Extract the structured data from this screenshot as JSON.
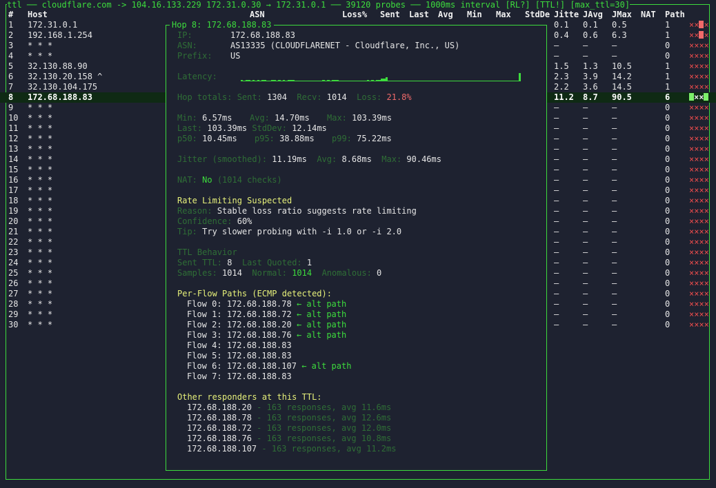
{
  "title_bar": "ttl ── cloudflare.com -> 104.16.133.229 172.31.0.30 → 172.31.0.1 ── 39120 probes ── 1000ms interval [RL?] [TTL!] [max_ttl=30]",
  "headers": {
    "num": "#",
    "host": "Host",
    "asn": "ASN",
    "loss": "Loss%",
    "sent": "Sent",
    "last": "Last",
    "avg": "Avg",
    "min": "Min",
    "max": "Max",
    "stddev": "StdDe",
    "jitter": "Jitte",
    "javg": "JAvg",
    "jmax": "JMax",
    "nat": "NAT",
    "path": "Path"
  },
  "rows": [
    {
      "n": "1",
      "host": "172.31.0.1",
      "j": "0.1",
      "ja": "0.1",
      "jm": "0.5",
      "p": "1",
      "flags": "××",
      "tail": "red-x"
    },
    {
      "n": "2",
      "host": "192.168.1.254",
      "j": "0.4",
      "ja": "0.6",
      "jm": "6.3",
      "p": "1",
      "flags": "××",
      "tail": "red-x"
    },
    {
      "n": "3",
      "host": "* * *",
      "j": "–",
      "ja": "–",
      "jm": "–",
      "p": "0",
      "flags": "××××"
    },
    {
      "n": "4",
      "host": "* * *",
      "j": "–",
      "ja": "–",
      "jm": "–",
      "p": "0",
      "flags": "××××"
    },
    {
      "n": "5",
      "host": "32.130.88.90",
      "j": "1.5",
      "ja": "1.3",
      "jm": "10.5",
      "p": "1",
      "flags": "××××"
    },
    {
      "n": "6",
      "host": "32.130.20.158 ^",
      "j": "2.3",
      "ja": "3.9",
      "jm": "14.2",
      "p": "1",
      "flags": "××××"
    },
    {
      "n": "7",
      "host": "32.130.104.175",
      "j": "2.2",
      "ja": "3.6",
      "jm": "14.5",
      "p": "1",
      "flags": "××××"
    },
    {
      "n": "8",
      "host": "172.68.188.83",
      "j": "11.2",
      "ja": "8.7",
      "jm": "90.5",
      "p": "6",
      "flags": "××",
      "tail": "green",
      "selected": true
    },
    {
      "n": "9",
      "host": "* * *",
      "j": "–",
      "ja": "–",
      "jm": "–",
      "p": "0",
      "flags": "××××"
    },
    {
      "n": "10",
      "host": "* * *",
      "j": "–",
      "ja": "–",
      "jm": "–",
      "p": "0",
      "flags": "××××"
    },
    {
      "n": "11",
      "host": "* * *",
      "j": "–",
      "ja": "–",
      "jm": "–",
      "p": "0",
      "flags": "××××"
    },
    {
      "n": "12",
      "host": "* * *",
      "j": "–",
      "ja": "–",
      "jm": "–",
      "p": "0",
      "flags": "××××"
    },
    {
      "n": "13",
      "host": "* * *",
      "j": "–",
      "ja": "–",
      "jm": "–",
      "p": "0",
      "flags": "××××"
    },
    {
      "n": "14",
      "host": "* * *",
      "j": "–",
      "ja": "–",
      "jm": "–",
      "p": "0",
      "flags": "××××"
    },
    {
      "n": "15",
      "host": "* * *",
      "j": "–",
      "ja": "–",
      "jm": "–",
      "p": "0",
      "flags": "××××"
    },
    {
      "n": "16",
      "host": "* * *",
      "j": "–",
      "ja": "–",
      "jm": "–",
      "p": "0",
      "flags": "××××"
    },
    {
      "n": "17",
      "host": "* * *",
      "j": "–",
      "ja": "–",
      "jm": "–",
      "p": "0",
      "flags": "××××"
    },
    {
      "n": "18",
      "host": "* * *",
      "j": "–",
      "ja": "–",
      "jm": "–",
      "p": "0",
      "flags": "××××"
    },
    {
      "n": "19",
      "host": "* * *",
      "j": "–",
      "ja": "–",
      "jm": "–",
      "p": "0",
      "flags": "××××"
    },
    {
      "n": "20",
      "host": "* * *",
      "j": "–",
      "ja": "–",
      "jm": "–",
      "p": "0",
      "flags": "××××"
    },
    {
      "n": "21",
      "host": "* * *",
      "j": "–",
      "ja": "–",
      "jm": "–",
      "p": "0",
      "flags": "××××"
    },
    {
      "n": "22",
      "host": "* * *",
      "j": "–",
      "ja": "–",
      "jm": "–",
      "p": "0",
      "flags": "××××"
    },
    {
      "n": "23",
      "host": "* * *",
      "j": "–",
      "ja": "–",
      "jm": "–",
      "p": "0",
      "flags": "××××"
    },
    {
      "n": "24",
      "host": "* * *",
      "j": "–",
      "ja": "–",
      "jm": "–",
      "p": "0",
      "flags": "××××"
    },
    {
      "n": "25",
      "host": "* * *",
      "j": "–",
      "ja": "–",
      "jm": "–",
      "p": "0",
      "flags": "××××"
    },
    {
      "n": "26",
      "host": "* * *",
      "j": "–",
      "ja": "–",
      "jm": "–",
      "p": "0",
      "flags": "××××"
    },
    {
      "n": "27",
      "host": "* * *",
      "j": "–",
      "ja": "–",
      "jm": "–",
      "p": "0",
      "flags": "××××"
    },
    {
      "n": "28",
      "host": "* * *",
      "j": "–",
      "ja": "–",
      "jm": "–",
      "p": "0",
      "flags": "××××"
    },
    {
      "n": "29",
      "host": "* * *",
      "j": "–",
      "ja": "–",
      "jm": "–",
      "p": "0",
      "flags": "××××"
    },
    {
      "n": "30",
      "host": "* * *",
      "j": "–",
      "ja": "–",
      "jm": "–",
      "p": "0",
      "flags": "××××"
    }
  ],
  "panel": {
    "title": "Hop 8: 172.68.188.83",
    "ip_label": "IP:",
    "ip": "172.68.188.83",
    "asn_label": "ASN:",
    "asn": "AS13335 (CLOUDFLARENET - Cloudflare, Inc., US)",
    "prefix_label": "Prefix:",
    "prefix": "US",
    "latency_label": "Latency:",
    "latency_spark": [
      1,
      0,
      1,
      1,
      0,
      1,
      0,
      1,
      0,
      1,
      1,
      0,
      0,
      1,
      1,
      0,
      1,
      0,
      1,
      0,
      1,
      1,
      1,
      0,
      0,
      0,
      0,
      0,
      0,
      0,
      0,
      0,
      0,
      0,
      0,
      1,
      0,
      1,
      0,
      1,
      1,
      1,
      0,
      0,
      0,
      0,
      0,
      0,
      0,
      0,
      0,
      0,
      0,
      0,
      1,
      0,
      1,
      0,
      1,
      1,
      2,
      2,
      3,
      0,
      0,
      0,
      0,
      0,
      0,
      0,
      0,
      0,
      0,
      0,
      0,
      0,
      0,
      0,
      0,
      0,
      0,
      0,
      0,
      0,
      0,
      0,
      0,
      0,
      0,
      0,
      0,
      0,
      0,
      0,
      0,
      0,
      0,
      0,
      0,
      0,
      0,
      0,
      0,
      0,
      0,
      0,
      0,
      0,
      0,
      0,
      0,
      0,
      0,
      0,
      0,
      0,
      0,
      0,
      0,
      6
    ],
    "totals_sent_label": "Hop totals: Sent:",
    "totals_sent": "1304",
    "totals_recv_label": "Recv:",
    "totals_recv": "1014",
    "totals_loss_label": "Loss:",
    "totals_loss": "21.8%",
    "min_label": "Min:",
    "min": "6.57ms",
    "avg_label": "Avg:",
    "avg": "14.70ms",
    "max_label": "Max:",
    "max": "103.39ms",
    "last_label": "Last:",
    "last": "103.39ms",
    "stddev_label": "StdDev:",
    "stddev": "12.14ms",
    "p50_label": "p50:",
    "p50": "10.45ms",
    "p95_label": "p95:",
    "p95": "38.88ms",
    "p99_label": "p99:",
    "p99": "75.22ms",
    "jitter_label": "Jitter (smoothed):",
    "jitter": "11.19ms",
    "javg_label": "Avg:",
    "javg": "8.68ms",
    "jmax_label": "Max:",
    "jmax": "90.46ms",
    "nat_label": "NAT:",
    "nat": "No",
    "nat_note": "(1014 checks)",
    "rl_heading": "Rate Limiting Suspected",
    "rl_reason_label": "Reason:",
    "rl_reason": "Stable loss ratio suggests rate limiting",
    "rl_conf_label": "Confidence:",
    "rl_conf": "60%",
    "rl_tip_label": "Tip:",
    "rl_tip": "Try slower probing with -i 1.0 or -i 2.0",
    "ttl_heading": "TTL Behavior",
    "sent_ttl_label": "Sent TTL:",
    "sent_ttl": "8",
    "last_quoted_label": "Last Quoted:",
    "last_quoted": "1",
    "samples_label": "Samples:",
    "samples": "1014",
    "normal_label": "Normal:",
    "normal": "1014",
    "anom_label": "Anomalous:",
    "anom": "0",
    "flows_heading": "Per-Flow Paths (ECMP detected):",
    "flows": [
      {
        "label": "Flow 0:",
        "ip": "172.68.188.78",
        "alt": "← alt path"
      },
      {
        "label": "Flow 1:",
        "ip": "172.68.188.72",
        "alt": "← alt path"
      },
      {
        "label": "Flow 2:",
        "ip": "172.68.188.20",
        "alt": "← alt path"
      },
      {
        "label": "Flow 3:",
        "ip": "172.68.188.76",
        "alt": "← alt path"
      },
      {
        "label": "Flow 4:",
        "ip": "172.68.188.83",
        "alt": ""
      },
      {
        "label": "Flow 5:",
        "ip": "172.68.188.83",
        "alt": ""
      },
      {
        "label": "Flow 6:",
        "ip": "172.68.188.107",
        "alt": "← alt path"
      },
      {
        "label": "Flow 7:",
        "ip": "172.68.188.83",
        "alt": ""
      }
    ],
    "others_heading": "Other responders at this TTL:",
    "others": [
      {
        "ip": "172.68.188.20",
        "note": "- 163 responses, avg 11.6ms"
      },
      {
        "ip": "172.68.188.78",
        "note": "- 163 responses, avg 12.6ms"
      },
      {
        "ip": "172.68.188.72",
        "note": "- 163 responses, avg 12.0ms"
      },
      {
        "ip": "172.68.188.76",
        "note": "- 163 responses, avg 10.8ms"
      },
      {
        "ip": "172.68.188.107",
        "note": "- 163 responses, avg 11.2ms"
      }
    ]
  }
}
